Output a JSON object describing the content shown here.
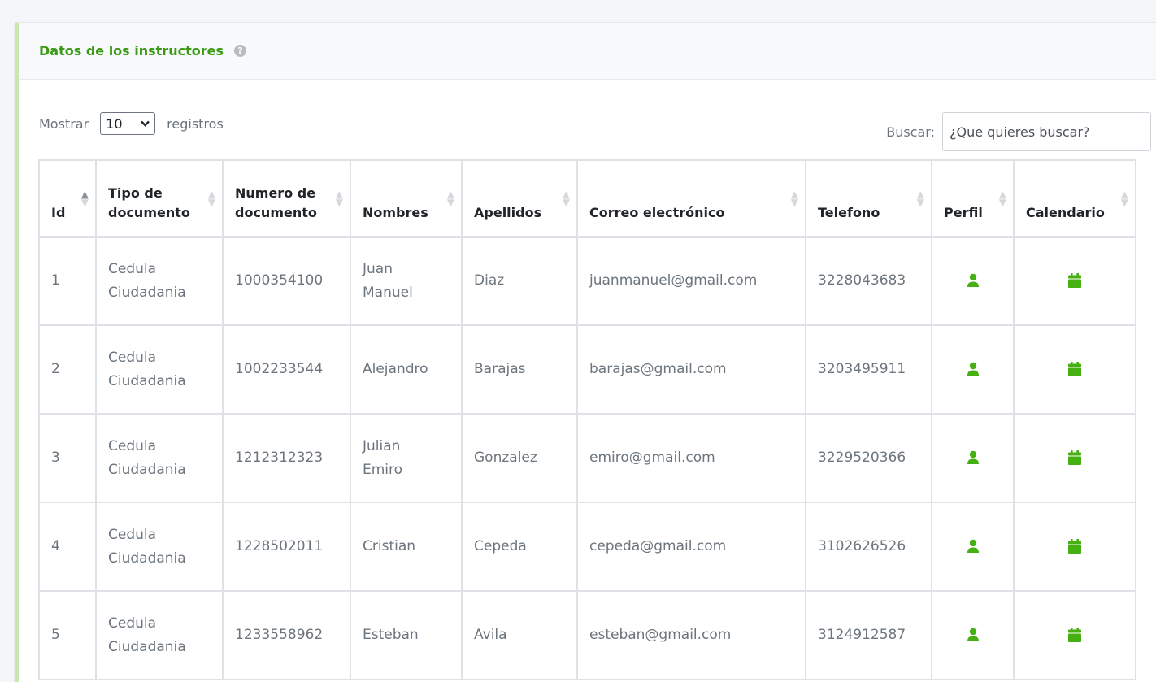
{
  "card": {
    "title": "Datos de los instructores",
    "help_glyph": "?"
  },
  "length_menu": {
    "prefix": "Mostrar",
    "selected": "10",
    "suffix": "registros"
  },
  "search": {
    "label": "Buscar:",
    "placeholder": "¿Que quieres buscar?"
  },
  "columns": {
    "id": "Id",
    "tipo_1": "Tipo de",
    "tipo_2": "documento",
    "numero_1": "Numero de",
    "numero_2": "documento",
    "nombres": "Nombres",
    "apellidos": "Apellidos",
    "correo": "Correo electrónico",
    "telefono": "Telefono",
    "perfil": "Perfil",
    "calendario": "Calendario"
  },
  "rows": [
    {
      "id": "1",
      "tipo_1": "Cedula",
      "tipo_2": "Ciudadania",
      "numero": "1000354100",
      "nombre_1": "Juan",
      "nombre_2": "Manuel",
      "apellidos": "Diaz",
      "correo": "juanmanuel@gmail.com",
      "telefono": "3228043683"
    },
    {
      "id": "2",
      "tipo_1": "Cedula",
      "tipo_2": "Ciudadania",
      "numero": "1002233544",
      "nombre_1": "Alejandro",
      "nombre_2": "",
      "apellidos": "Barajas",
      "correo": "barajas@gmail.com",
      "telefono": "3203495911"
    },
    {
      "id": "3",
      "tipo_1": "Cedula",
      "tipo_2": "Ciudadania",
      "numero": "1212312323",
      "nombre_1": "Julian",
      "nombre_2": "Emiro",
      "apellidos": "Gonzalez",
      "correo": "emiro@gmail.com",
      "telefono": "3229520366"
    },
    {
      "id": "4",
      "tipo_1": "Cedula",
      "tipo_2": "Ciudadania",
      "numero": "1228502011",
      "nombre_1": "Cristian",
      "nombre_2": "",
      "apellidos": "Cepeda",
      "correo": "cepeda@gmail.com",
      "telefono": "3102626526"
    },
    {
      "id": "5",
      "tipo_1": "Cedula",
      "tipo_2": "Ciudadania",
      "numero": "1233558962",
      "nombre_1": "Esteban",
      "nombre_2": "",
      "apellidos": "Avila",
      "correo": "esteban@gmail.com",
      "telefono": "3124912587"
    }
  ],
  "icons": {
    "profile": "user-icon",
    "calendar": "calendar-icon"
  },
  "colors": {
    "accent": "#3a9a14",
    "icon": "#46b012"
  }
}
